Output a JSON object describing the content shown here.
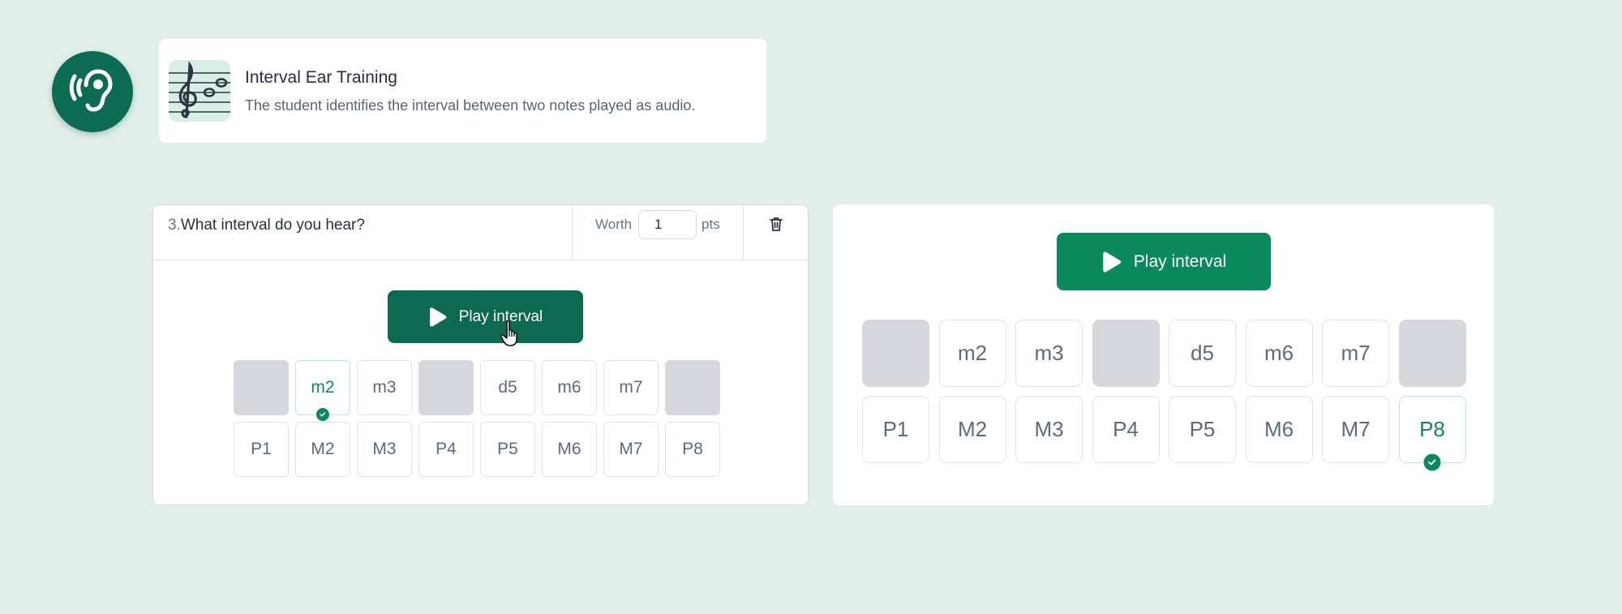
{
  "header": {
    "title": "Interval Ear Training",
    "description": "The student identifies the interval between two notes played as audio.",
    "badge_icon": "ear-icon",
    "thumbnail_icon": "treble-clef-staff-icon"
  },
  "editor": {
    "question_number": "3.",
    "question_text": "What interval do you hear?",
    "worth_label": "Worth",
    "points_value": "1",
    "points_unit": "pts",
    "delete_icon": "trash-icon",
    "play_label": "Play interval"
  },
  "preview": {
    "play_label": "Play interval"
  },
  "intervals": {
    "row1": [
      "",
      "m2",
      "m3",
      "",
      "d5",
      "m6",
      "m7",
      ""
    ],
    "row2": [
      "P1",
      "M2",
      "M3",
      "P4",
      "P5",
      "M6",
      "M7",
      "P8"
    ]
  },
  "selection": {
    "editor_selected": "m2",
    "preview_selected": "P8"
  },
  "colors": {
    "background": "#e2eeea",
    "brand_dark": "#0b6b53",
    "brand": "#0a8a5c",
    "empty_cell": "#d7d8de",
    "selected_text": "#11875e"
  }
}
